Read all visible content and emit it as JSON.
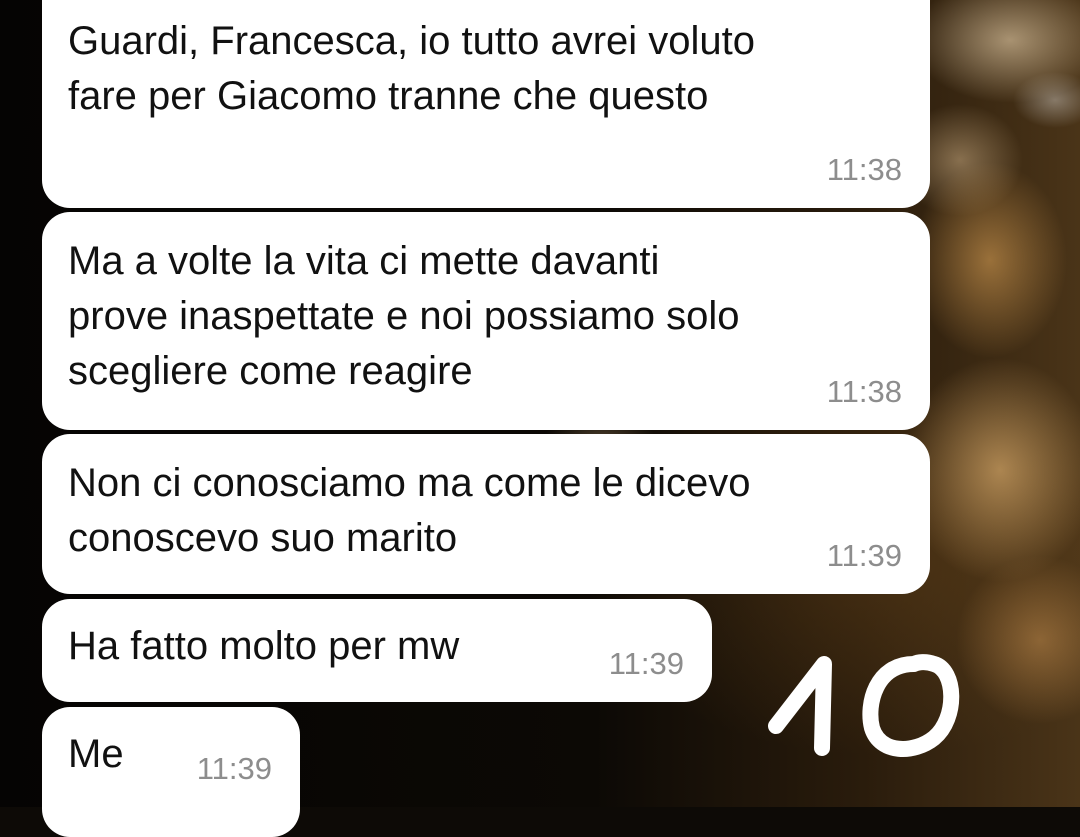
{
  "chat": {
    "messages": [
      {
        "text": "Guardi, Francesca, io tutto avrei voluto\nfare per Giacomo tranne che questo",
        "time": "11:38"
      },
      {
        "text": "Ma a volte la vita ci mette davanti\nprove inaspettate e noi possiamo solo\nscegliere come reagire",
        "time": "11:38"
      },
      {
        "text": "Non ci conosciamo ma come le dicevo\nconoscevo suo marito",
        "time": "11:39"
      },
      {
        "text": "Ha fatto molto per mw",
        "time": "11:39"
      },
      {
        "text": "Me",
        "time": "11:39"
      }
    ]
  },
  "annotation": {
    "label": "10",
    "color": "#ffffff"
  },
  "colors": {
    "bubble": "#ffffff",
    "message_text": "#111111",
    "timestamp": "#8d8d8d"
  }
}
